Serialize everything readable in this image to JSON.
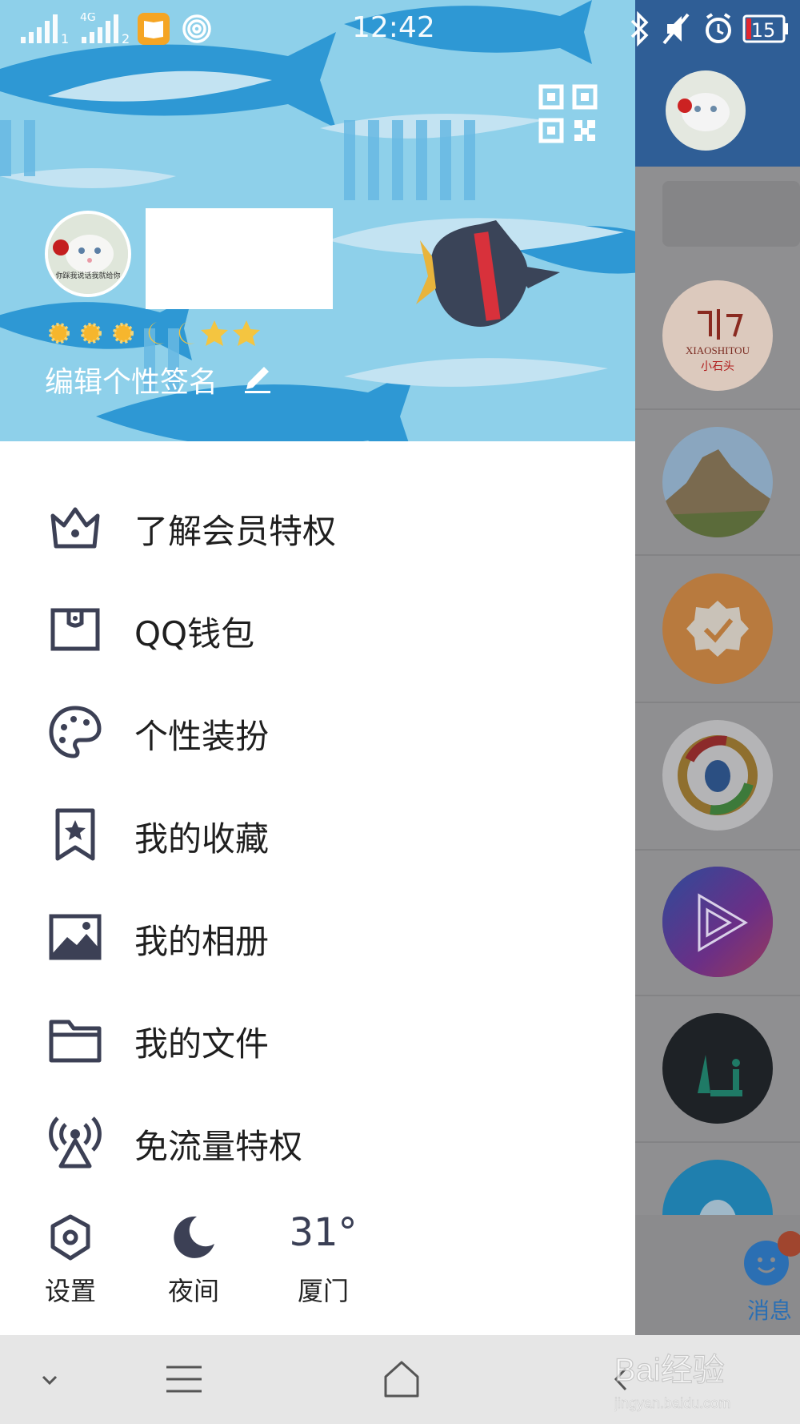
{
  "status_bar": {
    "time": "12:42",
    "signal_1": "1",
    "signal_2": "2",
    "network": "4G",
    "battery": "15"
  },
  "profile": {
    "avatar_caption": "你踩我说话我就给你",
    "signature": "编辑个性签名",
    "level_badges": [
      "sun",
      "sun",
      "sun",
      "moon",
      "moon",
      "star",
      "star"
    ]
  },
  "menu": {
    "items": [
      {
        "label": "了解会员特权",
        "icon": "crown-icon"
      },
      {
        "label": "QQ钱包",
        "icon": "wallet-icon"
      },
      {
        "label": "个性装扮",
        "icon": "palette-icon"
      },
      {
        "label": "我的收藏",
        "icon": "bookmark-star-icon"
      },
      {
        "label": "我的相册",
        "icon": "photo-icon"
      },
      {
        "label": "我的文件",
        "icon": "folder-icon"
      },
      {
        "label": "免流量特权",
        "icon": "broadcast-icon"
      }
    ]
  },
  "bottom": {
    "settings_label": "设置",
    "night_label": "夜间",
    "temperature": "31°",
    "city": "厦门"
  },
  "right_panel": {
    "tab_label": "消息",
    "contact_texts": [
      "XIAOSHITOU",
      "小石头"
    ]
  },
  "watermark": {
    "text": "Bai经验",
    "url": "jingyan.baidu.com"
  },
  "colors": {
    "header_sky": "#8ed0ea",
    "fish_dark": "#2e98d4",
    "icon_gray": "#3c4055",
    "accent_blue": "#2b6fb3"
  }
}
